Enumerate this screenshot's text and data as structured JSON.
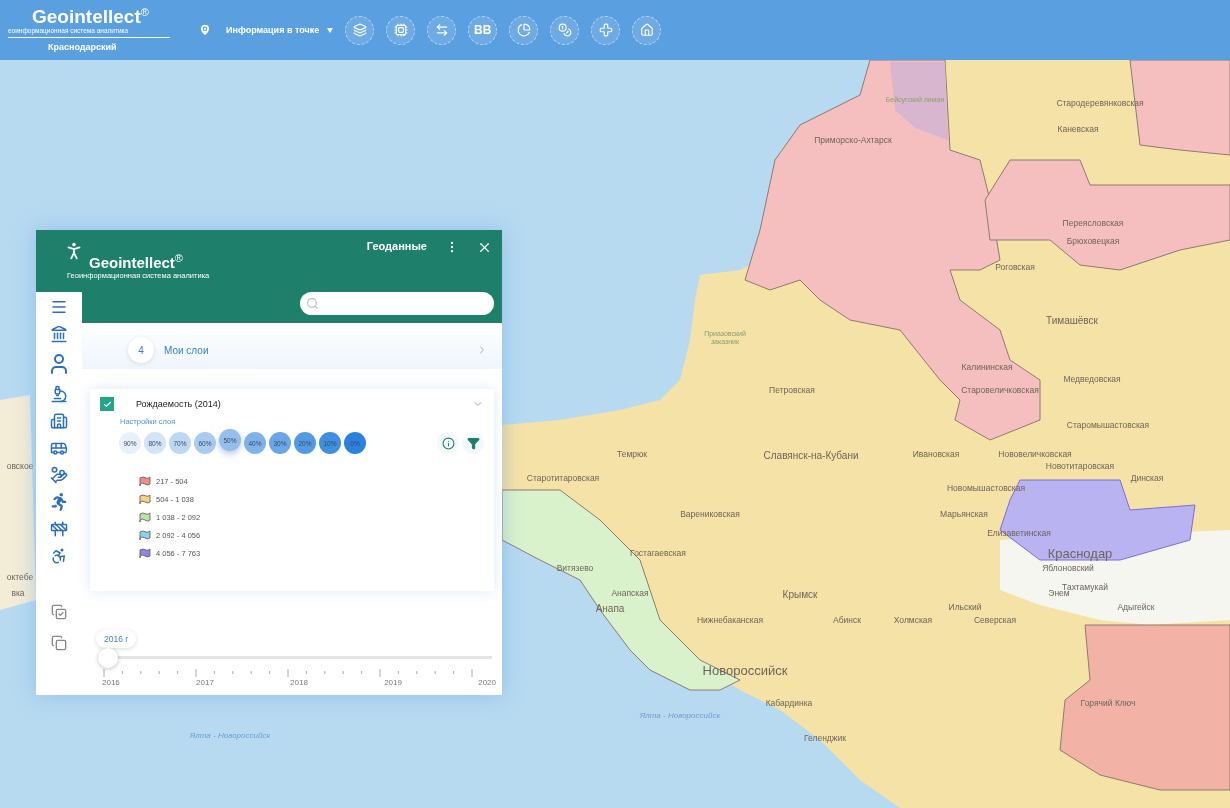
{
  "topbar": {
    "logo": {
      "name": "Geointellect",
      "mark": "®",
      "subtitle": "еоинформационная система аналитика"
    },
    "region": "Краснодарский",
    "location_mode": "Информация в точке",
    "text_button": "BB"
  },
  "map_labels": [
    {
      "text": "Бейсугский лиман",
      "kind": "reserve"
    },
    {
      "text": "Стародеревянковская",
      "kind": "town"
    },
    {
      "text": "Каневская",
      "kind": "town"
    },
    {
      "text": "Приморско-Ахтарск",
      "kind": "town"
    },
    {
      "text": "Переясловская",
      "kind": "town"
    },
    {
      "text": "Брюховецкая",
      "kind": "town"
    },
    {
      "text": "Роговская",
      "kind": "town"
    },
    {
      "text": "Тимашёвск",
      "kind": "city"
    },
    {
      "text": "Приазовский заказник",
      "kind": "reserve"
    },
    {
      "text": "Калининская",
      "kind": "town"
    },
    {
      "text": "Медведовская",
      "kind": "town"
    },
    {
      "text": "Петровская",
      "kind": "town"
    },
    {
      "text": "Старовеличковская",
      "kind": "town"
    },
    {
      "text": "Старомышастовская",
      "kind": "town"
    },
    {
      "text": "Темрюк",
      "kind": "town"
    },
    {
      "text": "Славянск-на-Кубани",
      "kind": "city"
    },
    {
      "text": "Ивановская",
      "kind": "town"
    },
    {
      "text": "Нововеличковская",
      "kind": "town"
    },
    {
      "text": "овское",
      "kind": "town"
    },
    {
      "text": "Новотитаровская",
      "kind": "town"
    },
    {
      "text": "Старотитаровская",
      "kind": "town"
    },
    {
      "text": "Динская",
      "kind": "town"
    },
    {
      "text": "Новомышастовская",
      "kind": "town"
    },
    {
      "text": "Варениковская",
      "kind": "town"
    },
    {
      "text": "Марьянская",
      "kind": "town"
    },
    {
      "text": "Елизаветинская",
      "kind": "town"
    },
    {
      "text": "Гостагаевская",
      "kind": "town"
    },
    {
      "text": "Краснодар",
      "kind": "capital"
    },
    {
      "text": "Витязево",
      "kind": "town"
    },
    {
      "text": "Яблоновский",
      "kind": "town"
    },
    {
      "text": "октебе",
      "kind": "town"
    },
    {
      "text": "Тахтамукай",
      "kind": "town"
    },
    {
      "text": "вка",
      "kind": "town"
    },
    {
      "text": "Анапская",
      "kind": "town"
    },
    {
      "text": "Крымск",
      "kind": "city"
    },
    {
      "text": "Энем",
      "kind": "town"
    },
    {
      "text": "Анапа",
      "kind": "city"
    },
    {
      "text": "Ильский",
      "kind": "town"
    },
    {
      "text": "Адыгейск",
      "kind": "town"
    },
    {
      "text": "Нижнебаканская",
      "kind": "town"
    },
    {
      "text": "Абинск",
      "kind": "town"
    },
    {
      "text": "Холмская",
      "kind": "town"
    },
    {
      "text": "Северская",
      "kind": "town"
    },
    {
      "text": "Новороссийск",
      "kind": "capital"
    },
    {
      "text": "Кабардинка",
      "kind": "town"
    },
    {
      "text": "Горячий Ключ",
      "kind": "town"
    },
    {
      "text": "Ялта - Новороссийск",
      "kind": "route"
    },
    {
      "text": "Ялта - Новороссийск",
      "kind": "route"
    },
    {
      "text": "Геленджик",
      "kind": "town"
    }
  ],
  "panel": {
    "title": "Геоданные",
    "logo": {
      "name": "Geointellect",
      "mark": "®",
      "subtitle": "Геоинформационная система аналитика"
    },
    "my_layers": {
      "count": "4",
      "label": "Мои слои"
    },
    "layer": {
      "name": "Рождаемость (2014)",
      "checked": true,
      "expanded": true,
      "settings_label": "Настройки слоя",
      "opacity": [
        {
          "label": "90%",
          "selected": false
        },
        {
          "label": "80%",
          "selected": false
        },
        {
          "label": "70%",
          "selected": false
        },
        {
          "label": "60%",
          "selected": false
        },
        {
          "label": "50%",
          "selected": true
        },
        {
          "label": "40%",
          "selected": false
        },
        {
          "label": "30%",
          "selected": false
        },
        {
          "label": "20%",
          "selected": false
        },
        {
          "label": "10%",
          "selected": false
        },
        {
          "label": "0%",
          "selected": false
        }
      ],
      "legend": [
        {
          "label": "217 - 504",
          "color": "#f28b8b"
        },
        {
          "label": "504 - 1 038",
          "color": "#f5d37a"
        },
        {
          "label": "1 038 - 2 092",
          "color": "#b8e6a8"
        },
        {
          "label": "2 092 - 4 056",
          "color": "#8fd0ee"
        },
        {
          "label": "4 056 - 7 763",
          "color": "#8f86e6"
        }
      ]
    },
    "timeline": {
      "current": "2016 г",
      "level": 0,
      "years": [
        "2016",
        "2017",
        "2018",
        "2019",
        "2020"
      ]
    }
  }
}
